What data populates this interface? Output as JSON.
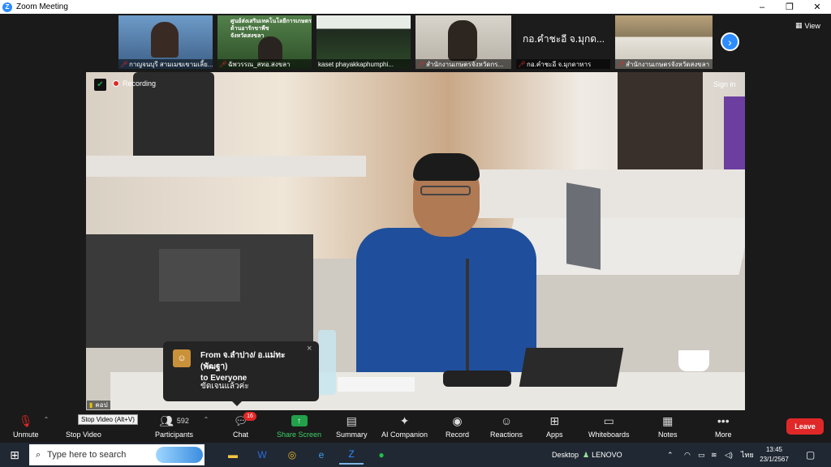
{
  "window": {
    "title": "Zoom Meeting",
    "controls": [
      "–",
      "❐",
      "✕"
    ]
  },
  "thumbnails": [
    {
      "name": "กาญจนบุรี สามเมฆเขามเลี้ย...",
      "bg": "#5a7fa8"
    },
    {
      "name": "ฉัพวรรณ_สทอ.สงขลา",
      "bg": "#3f6b3a",
      "overlay_lines": [
        "ศูนย์ส่งเสริมเทคโนโลยีการเกษตร",
        "ด้านอารักขาพืช",
        "จังหวัดสงขลา"
      ]
    },
    {
      "name": "kaset phayakkaphumphi...",
      "bg": "#2e2e2e"
    },
    {
      "name": "สำนักงานเกษตรจังหวัดกร...",
      "bg": "#c4c0b8"
    },
    {
      "name": "กอ.คำชะอี จ.มุกดาหาร",
      "bg": "#1c1c1c",
      "big_text": "กอ.คำชะอี จ.มุกด..."
    },
    {
      "name": "สำนักงานเกษตรจังหวัดสงขลา",
      "bg": "#8a8270"
    }
  ],
  "strip": {
    "view_label": "View"
  },
  "main_video": {
    "recording_label": "Recording",
    "sign_in_label": "Sign in",
    "participant_name": "คอป"
  },
  "chat_popup": {
    "from_line1": "From จ.ลำปาง/ อ.แม่ทะ (พัฒฐา)",
    "from_line2": "to Everyone",
    "message": "ขัดเจนแล้วค่ะ",
    "close": "×"
  },
  "toolbar": {
    "tooltip": "Stop Video (Alt+V)",
    "participants_count": "592",
    "chat_badge": "16",
    "buttons": [
      {
        "key": "unmute",
        "label": "Unmute"
      },
      {
        "key": "stop_video",
        "label": "Stop Video"
      },
      {
        "key": "participants",
        "label": "Participants"
      },
      {
        "key": "chat",
        "label": "Chat"
      },
      {
        "key": "share_screen",
        "label": "Share Screen"
      },
      {
        "key": "summary",
        "label": "Summary"
      },
      {
        "key": "ai_companion",
        "label": "AI Companion"
      },
      {
        "key": "record",
        "label": "Record"
      },
      {
        "key": "reactions",
        "label": "Reactions"
      },
      {
        "key": "apps",
        "label": "Apps"
      },
      {
        "key": "whiteboards",
        "label": "Whiteboards"
      },
      {
        "key": "notes",
        "label": "Notes"
      },
      {
        "key": "more",
        "label": "More"
      }
    ],
    "leave_label": "Leave"
  },
  "taskbar": {
    "search_placeholder": "Type here to search",
    "desktop_label": "Desktop",
    "lenovo_label": "LENOVO",
    "language": "ไทย",
    "time": "13:45",
    "date": "23/1/2567"
  },
  "colors": {
    "zoom_blue": "#2d8cff",
    "leave_red": "#e02828",
    "share_green": "#23a04a",
    "muted_red": "#e02828"
  }
}
